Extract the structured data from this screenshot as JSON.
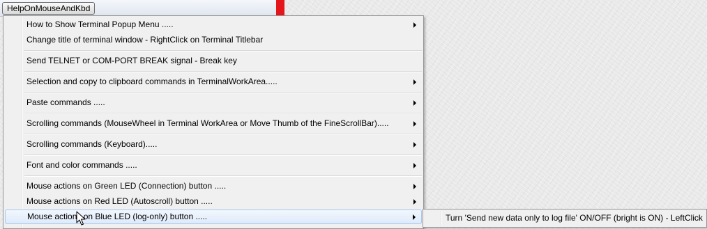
{
  "toolbar": {
    "menu_button_label": "HelpOnMouseAndKbd"
  },
  "popup_menu": {
    "items": [
      {
        "label": "How to Show Terminal Popup Menu .....",
        "has_submenu": true
      },
      {
        "label": "Change title of terminal window - RightClick on Terminal Titlebar",
        "has_submenu": false
      },
      {
        "label": "Send TELNET or COM-PORT BREAK signal - Break key",
        "has_submenu": false
      },
      {
        "label": "Selection and copy to clipboard commands in TerminalWorkArea.....",
        "has_submenu": true
      },
      {
        "label": "Paste commands .....",
        "has_submenu": true
      },
      {
        "label": "Scrolling commands (MouseWheel in Terminal WorkArea or Move Thumb of the FineScrollBar).....",
        "has_submenu": true
      },
      {
        "label": "Scrolling commands (Keyboard).....",
        "has_submenu": true
      },
      {
        "label": "Font and color commands .....",
        "has_submenu": true
      },
      {
        "label": "Mouse actions on Green LED (Connection) button .....",
        "has_submenu": true
      },
      {
        "label": "Mouse actions on Red LED (Autoscroll) button .....",
        "has_submenu": true
      },
      {
        "label": "Mouse actions on Blue LED (log-only) button .....",
        "has_submenu": true,
        "highlighted": true
      }
    ]
  },
  "submenu": {
    "items": [
      {
        "label": "Turn 'Send new data only to log file' ON/OFF (bright is ON) - LeftClick"
      }
    ]
  },
  "colors": {
    "led_strip": "#e4151b",
    "menu_background": "#f0f0f0",
    "highlight_border": "#a8c7ee"
  },
  "cursor": {
    "icon": "arrow-cursor-icon"
  }
}
